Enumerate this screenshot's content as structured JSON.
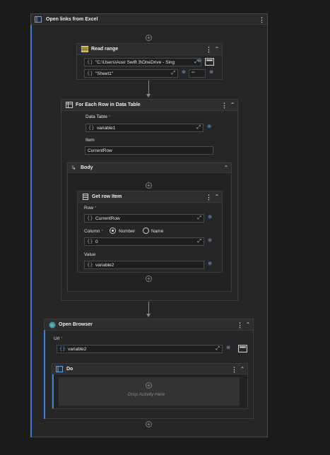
{
  "main": {
    "title": "Open links from Excel"
  },
  "read_range": {
    "title": "Read range",
    "path_value": "\"C:\\Users\\Acer Swift 3\\OneDrive - Sing",
    "sheet_value": "\"Sheet1\"",
    "range_value": "\"\""
  },
  "for_each": {
    "title": "For Each Row in Data Table",
    "data_table_label": "Data Table",
    "data_table_value": "variable1",
    "item_label": "Item",
    "item_value": "CurrentRow",
    "body_title": "Body"
  },
  "get_row": {
    "title": "Get row Item",
    "row_label": "Row",
    "row_value": "CurrentRow",
    "column_label": "Column",
    "option_number": "Number",
    "option_name": "Name",
    "column_value": "0",
    "value_label": "Value",
    "value_value": "variable2"
  },
  "open_browser": {
    "title": "Open Browser",
    "url_label": "Url",
    "url_value": "variable2",
    "do_title": "Do",
    "drop_hint": "Drop Activity Here"
  },
  "icons": {
    "expression": "{}",
    "expand": "expand-icon",
    "plus": "+"
  },
  "colors": {
    "accent_blue": "#3d7fd6",
    "background": "#1b1b1b",
    "panel": "#262626"
  }
}
